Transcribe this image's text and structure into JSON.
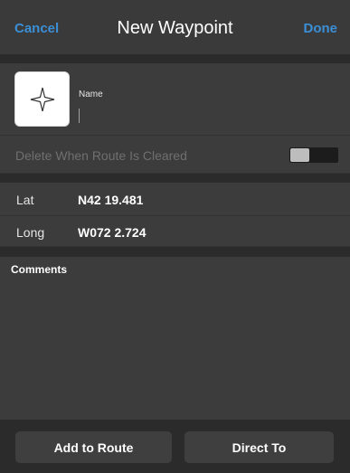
{
  "nav": {
    "cancel_label": "Cancel",
    "title": "New Waypoint",
    "done_label": "Done"
  },
  "waypoint": {
    "icon": "four-point-star-icon",
    "name_label": "Name",
    "name_value": ""
  },
  "delete_when_cleared": {
    "label": "Delete When Route Is Cleared",
    "enabled": false
  },
  "coordinates": {
    "lat_label": "Lat",
    "lat_value": "N42 19.481",
    "long_label": "Long",
    "long_value": "W072 2.724"
  },
  "comments": {
    "label": "Comments",
    "value": ""
  },
  "actions": {
    "add_to_route_label": "Add to Route",
    "direct_to_label": "Direct To"
  },
  "colors": {
    "accent": "#3a8fd6",
    "background": "#3c3c3c",
    "separator": "#2b2b2b"
  }
}
